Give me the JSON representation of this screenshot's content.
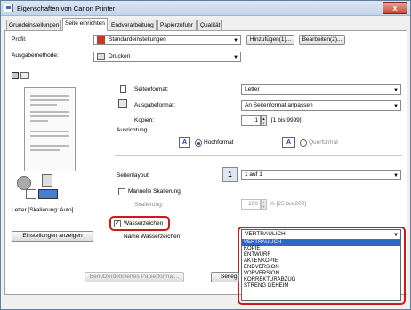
{
  "window": {
    "title": "Eigenschaften von Canon Printer",
    "close_label": "x"
  },
  "tabs": [
    {
      "label": "Grundeinstellungen"
    },
    {
      "label": "Seite einrichten"
    },
    {
      "label": "Endverarbeitung"
    },
    {
      "label": "Papierzufuhr"
    },
    {
      "label": "Qualität"
    }
  ],
  "profile": {
    "label": "Profil:",
    "value": "Standardeinstellungen",
    "add_label": "Hinzufügen(1)...",
    "edit_label": "Bearbeiten(2)..."
  },
  "output": {
    "label": "Ausgabemethode:",
    "value": "Drucken"
  },
  "preview": {
    "caption": "Letter [Skalierung: Auto]",
    "settings_button": "Einstellungen anzeigen"
  },
  "page_format": {
    "label": "Seitenformat:",
    "value": "Letter"
  },
  "output_format": {
    "label": "Ausgabeformat:",
    "value": "An Seitenformat anpassen"
  },
  "copies": {
    "label": "Kopien:",
    "value": "1",
    "range": "[1 bis 9999]"
  },
  "orientation": {
    "label": "Ausrichtung",
    "portrait": "Hochformat",
    "landscape": "Querformat"
  },
  "layout": {
    "label": "Seitenlayout:",
    "icon_text": "1",
    "value": "1 auf 1"
  },
  "manual_scaling": {
    "label": "Manuelle Skalierung"
  },
  "scaling": {
    "label": "Skalierung:",
    "value": "100",
    "range": "% [25 bis 200]"
  },
  "watermark": {
    "label": "Wasserzeichen",
    "name_label": "Name Wasserzeichen:",
    "value": "VERTRAULICH",
    "options": [
      "VERTRAULICH",
      "KOPIE",
      "ENTWURF",
      "AKTENKOPIE",
      "ENDVERSION",
      "VORVERSION",
      "KORREKTURABZUG",
      "STRENG GEHEIM"
    ],
    "selected_index": 0
  },
  "bottom": {
    "custom_paper": "Benutzerdefiniertes Papierformat...",
    "page_setup": "Seiteg"
  },
  "colors": {
    "highlight": "#cc1a1a",
    "selection": "#3166c6"
  }
}
